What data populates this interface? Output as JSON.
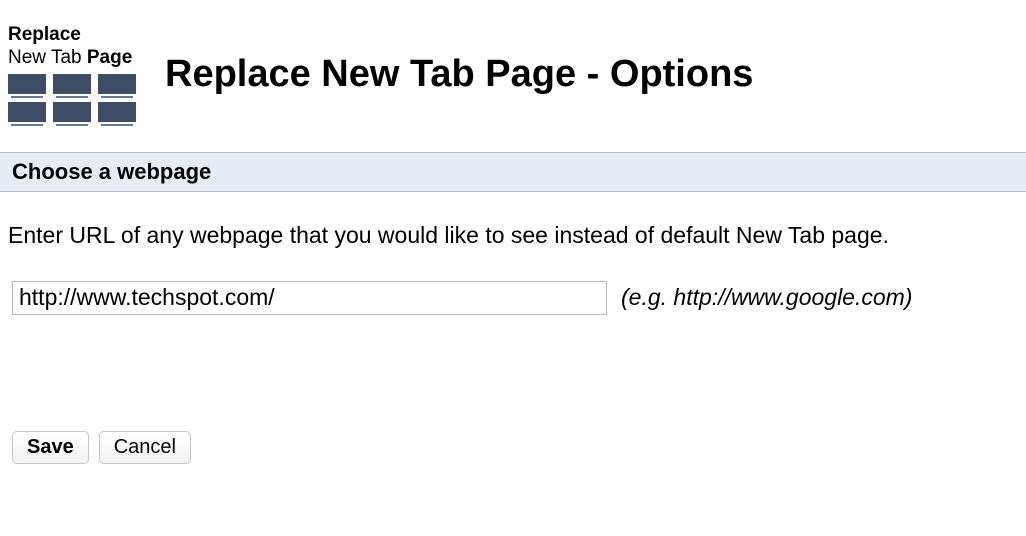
{
  "logo": {
    "line1_bold": "Replace",
    "line2_light": "New Tab",
    "line2_bold": "Page"
  },
  "header": {
    "title": "Replace New Tab Page - Options"
  },
  "section": {
    "heading": "Choose a webpage",
    "instruction": "Enter URL of any webpage that you would like to see instead of default New Tab page.",
    "url_value": "http://www.techspot.com/",
    "example": "(e.g. http://www.google.com)"
  },
  "buttons": {
    "save": "Save",
    "cancel": "Cancel"
  }
}
